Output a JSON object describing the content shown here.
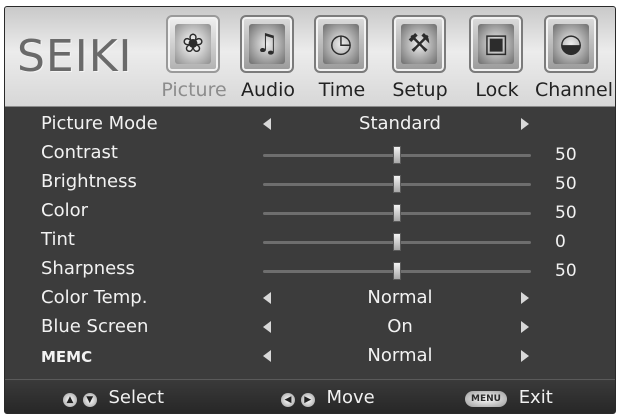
{
  "brand": "SEIKI",
  "tabs": [
    {
      "label": "Picture",
      "icon": "picture-icon",
      "glyph": "❀",
      "active": true
    },
    {
      "label": "Audio",
      "icon": "audio-icon",
      "glyph": "♫",
      "active": false
    },
    {
      "label": "Time",
      "icon": "clock-icon",
      "glyph": "◷",
      "active": false
    },
    {
      "label": "Setup",
      "icon": "tools-icon",
      "glyph": "⚒",
      "active": false
    },
    {
      "label": "Lock",
      "icon": "lock-icon",
      "glyph": "▣",
      "active": false
    },
    {
      "label": "Channel",
      "icon": "satellite-dish-icon",
      "glyph": "◒",
      "active": false
    }
  ],
  "rows": [
    {
      "label": "Picture Mode",
      "type": "select",
      "value": "Standard"
    },
    {
      "label": "Contrast",
      "type": "slider",
      "value": "50",
      "level": 0.5
    },
    {
      "label": "Brightness",
      "type": "slider",
      "value": "50",
      "level": 0.5
    },
    {
      "label": "Color",
      "type": "slider",
      "value": "50",
      "level": 0.5
    },
    {
      "label": "Tint",
      "type": "slider",
      "value": "0",
      "level": 0.5
    },
    {
      "label": "Sharpness",
      "type": "slider",
      "value": "50",
      "level": 0.5
    },
    {
      "label": "Color Temp.",
      "type": "select",
      "value": "Normal"
    },
    {
      "label": "Blue Screen",
      "type": "select",
      "value": "On"
    },
    {
      "label": "MEMC",
      "type": "select",
      "value": "Normal"
    }
  ],
  "footer": {
    "select_label": "Select",
    "move_label": "Move",
    "menu_key": "MENU",
    "exit_label": "Exit"
  }
}
